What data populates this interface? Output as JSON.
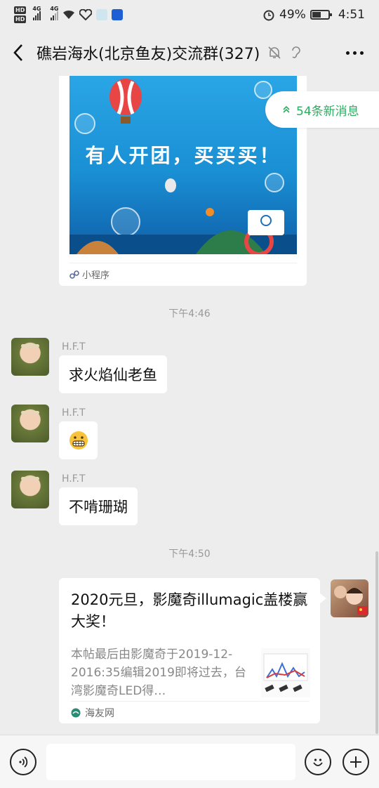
{
  "status_bar": {
    "battery": "49%",
    "time": "4:51",
    "net1": "4G",
    "net2": "4G"
  },
  "header": {
    "title": "礁岩海水(北京鱼友)交流群(327)"
  },
  "new_messages": "54条新消息",
  "mini_program": {
    "banner_text": "有人开团，买买买！",
    "footer_label": "小程序"
  },
  "timestamps": [
    "下午4:46",
    "下午4:50"
  ],
  "messages": [
    {
      "sender": "H.F.T",
      "text": "求火焰仙老鱼"
    },
    {
      "sender": "H.F.T",
      "emoji": "😬"
    },
    {
      "sender": "H.F.T",
      "text": "不啃珊瑚"
    }
  ],
  "link_card": {
    "title": "2020元旦，影魔奇illumagic盖楼赢大奖！",
    "description": "本帖最后由影魔奇于2019-12-2016:35编辑2019即将过去，台湾影魔奇LED得…",
    "source": "海友网"
  },
  "colors": {
    "accent_green": "#2bae60",
    "chat_bg": "#ededed"
  }
}
